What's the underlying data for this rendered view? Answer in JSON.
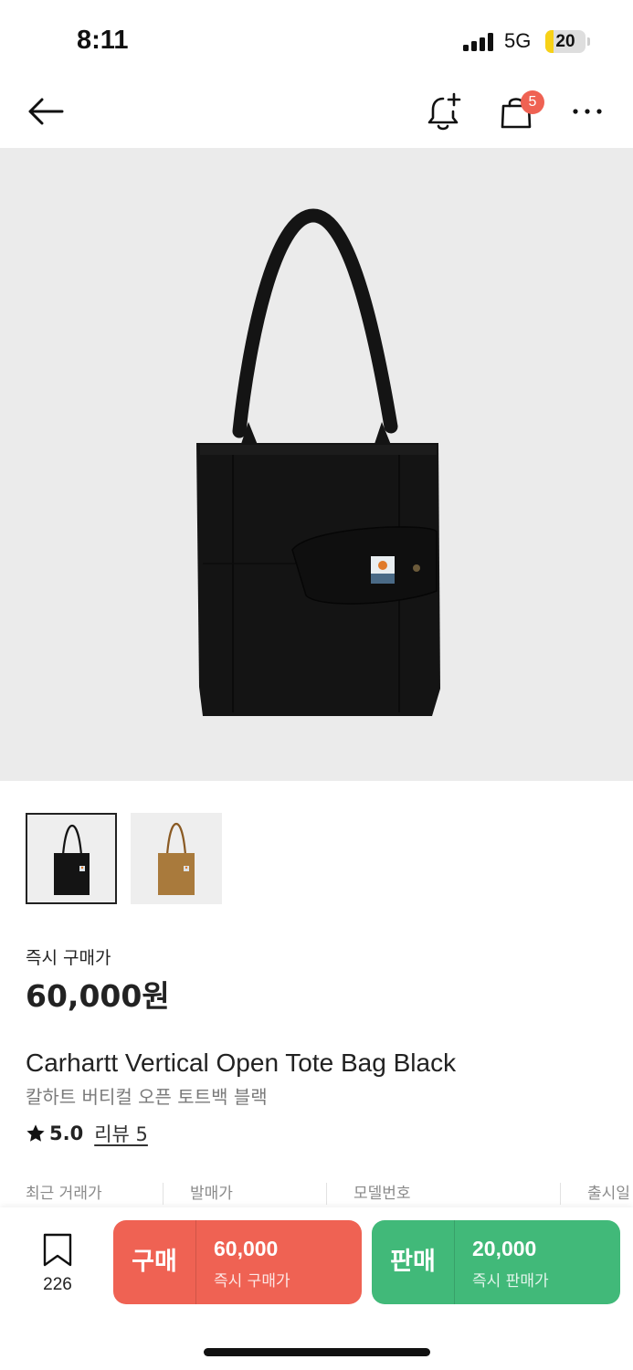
{
  "status_bar": {
    "time": "8:11",
    "network": "5G",
    "battery": "20",
    "battery_level": 0.2
  },
  "nav": {
    "cart_badge": "5"
  },
  "product": {
    "price_label": "즉시 구매가",
    "price": "60,000원",
    "title_en": "Carhartt Vertical Open Tote Bag Black",
    "title_ko": "칼하트 버티컬 오픈 토트백 블랙",
    "rating": "5.0",
    "review_link": "리뷰 5"
  },
  "specs": {
    "recent_price_label": "최근 거래가",
    "release_price_label": "발매가",
    "model_label": "모델번호",
    "release_date_label": "출시일"
  },
  "bottom_bar": {
    "wish_count": "226",
    "buy": {
      "type": "구매",
      "price": "60,000",
      "sub": "즉시 구매가"
    },
    "sell": {
      "type": "판매",
      "price": "20,000",
      "sub": "즉시 판매가"
    }
  },
  "colors": {
    "buy": "#ef6253",
    "sell": "#41b979",
    "badge": "#ef6253",
    "image_background": "#ebebeb"
  },
  "icons": [
    "back-arrow-icon",
    "bell-plus-icon",
    "shopping-bag-icon",
    "more-icon",
    "bookmark-icon",
    "star-icon"
  ]
}
